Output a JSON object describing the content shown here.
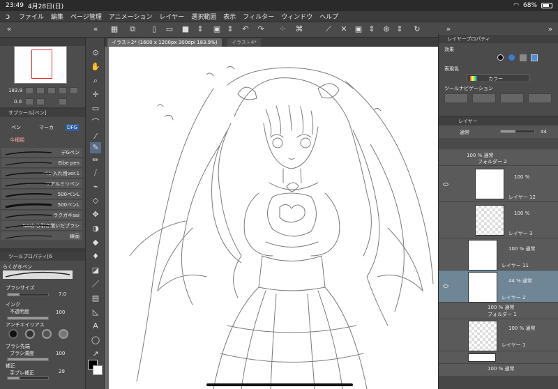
{
  "status": {
    "time": "23:49",
    "date": "4月28日(日)",
    "battery": "68%"
  },
  "menu": {
    "logo_icon": "clip-studio-logo-icon",
    "items": [
      "ファイル",
      "編集",
      "ページ管理",
      "アニメーション",
      "レイヤー",
      "選択範囲",
      "表示",
      "フィルター",
      "ウィンドウ",
      "ヘルプ"
    ]
  },
  "tabs": [
    {
      "label": "イラスト2* (1600 x 1200px 300dpi 183.9%)",
      "active": true
    },
    {
      "label": "イラスト4*",
      "active": false
    }
  ],
  "navigator": {
    "zoom": "183.9",
    "rotation": "0.0"
  },
  "subtool": {
    "title": "サブツール[ペン]",
    "tabs": [
      "ペン",
      "マーカ",
      "DFG"
    ],
    "group": "今種類",
    "brushes": [
      "デGペン",
      "Eibe pen",
      "ペン入れ用ver.1",
      "リアルミリペン",
      "500ペンL",
      "500ペンL",
      "ラクガキsai",
      "SAIから引き継いだブラシ",
      "線画"
    ]
  },
  "toolprop": {
    "title": "ツールプロパティ[6",
    "current": "らくがきペン",
    "brush_size_label": "ブラシサイズ",
    "brush_size": "7.0",
    "ink_label": "インク",
    "opacity_label": "不透明度",
    "opacity": "100",
    "antialias_label": "アンチエイリアス",
    "tip_label": "ブラシ先端",
    "density_label": "ブラシ濃度",
    "density": "100",
    "correction_label": "補正",
    "stabilization_label": "手ブレ補正",
    "stabilization": "29"
  },
  "layerprop": {
    "title": "レイヤープロパティ",
    "effect_label": "効果",
    "color_label": "表現色",
    "color_value": "カラー",
    "toolnav_label": "ツールナビゲーション"
  },
  "layers": {
    "title": "レイヤー",
    "blend": "通常",
    "opacity": "44",
    "rows": [
      {
        "type": "folder",
        "line1": "100 % 通常",
        "line2": "フォルダー 2"
      },
      {
        "type": "layer",
        "line1": "100 %",
        "line2": "レイヤー 12"
      },
      {
        "type": "layer",
        "line1": "100 %",
        "line2": "レイヤー 3"
      },
      {
        "type": "layer",
        "line1": "100 % 通常",
        "line2": "レイヤー 11"
      },
      {
        "type": "layer",
        "line1": "44 % 通常",
        "line2": "レイヤー 2",
        "selected": true
      },
      {
        "type": "folder",
        "line1": "100 % 通常",
        "line2": "フォルダー 1"
      },
      {
        "type": "layer",
        "line1": "100 % 通常",
        "line2": "レイヤー 1"
      },
      {
        "type": "paper",
        "line1": "",
        "line2": ""
      },
      {
        "type": "folder",
        "line1": "100 % 通常",
        "line2": ""
      }
    ]
  },
  "colors": {
    "selected_layer": "#6f8696",
    "panel": "#4b4b4b",
    "nav_frame": "#e03030"
  }
}
